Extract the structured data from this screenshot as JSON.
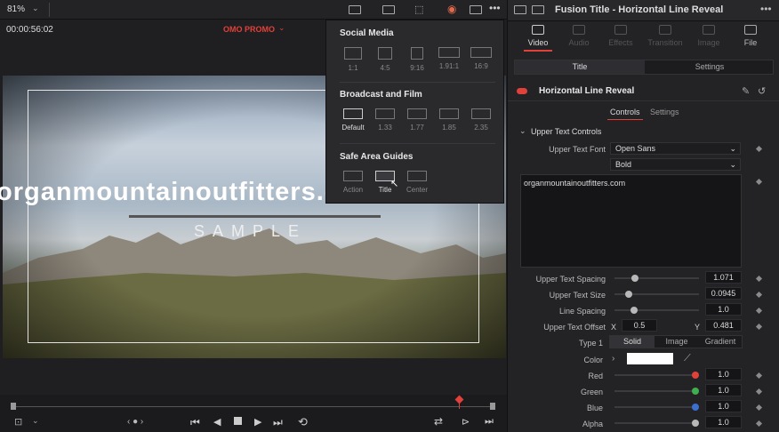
{
  "viewer": {
    "zoom": "81%",
    "timecode": "00:00:56:02",
    "timeline_name": "OMO PROMO",
    "title_text": "organmountainoutfitters.com",
    "sample_text": "SAMPLE"
  },
  "dropdown": {
    "social_title": "Social Media",
    "social": [
      "1:1",
      "4:5",
      "9:16",
      "1.91:1",
      "16:9"
    ],
    "broadcast_title": "Broadcast and Film",
    "broadcast": [
      "Default",
      "1.33",
      "1.77",
      "1.85",
      "2.35"
    ],
    "safe_title": "Safe Area Guides",
    "safe": [
      "Action",
      "Title",
      "Center"
    ]
  },
  "inspector": {
    "window_title": "Fusion Title - Horizontal Line Reveal",
    "tabs": [
      "Video",
      "Audio",
      "Effects",
      "Transition",
      "Image",
      "File"
    ],
    "subtabs": [
      "Title",
      "Settings"
    ],
    "effect_name": "Horizontal Line Reveal",
    "ctrl_tabs": [
      "Controls",
      "Settings"
    ],
    "section": "Upper Text Controls",
    "font_label": "Upper Text Font",
    "font_value": "Open Sans",
    "style_value": "Bold",
    "text_value": "organmountainoutfitters.com",
    "spacing_label": "Upper Text Spacing",
    "spacing_value": "1.071",
    "size_label": "Upper Text Size",
    "size_value": "0.0945",
    "line_label": "Line Spacing",
    "line_value": "1.0",
    "offset_label": "Upper Text Offset",
    "offset_x_label": "X",
    "offset_x": "0.5",
    "offset_y_label": "Y",
    "offset_y": "0.481",
    "type_label": "Type 1",
    "type_options": [
      "Solid",
      "Image",
      "Gradient"
    ],
    "color_label": "Color",
    "red_label": "Red",
    "red_value": "1.0",
    "green_label": "Green",
    "green_value": "1.0",
    "blue_label": "Blue",
    "blue_value": "1.0",
    "alpha_label": "Alpha",
    "alpha_value": "1.0"
  },
  "colors": {
    "accent_red": "#e0413a",
    "timeline_name": "#e0413a"
  }
}
